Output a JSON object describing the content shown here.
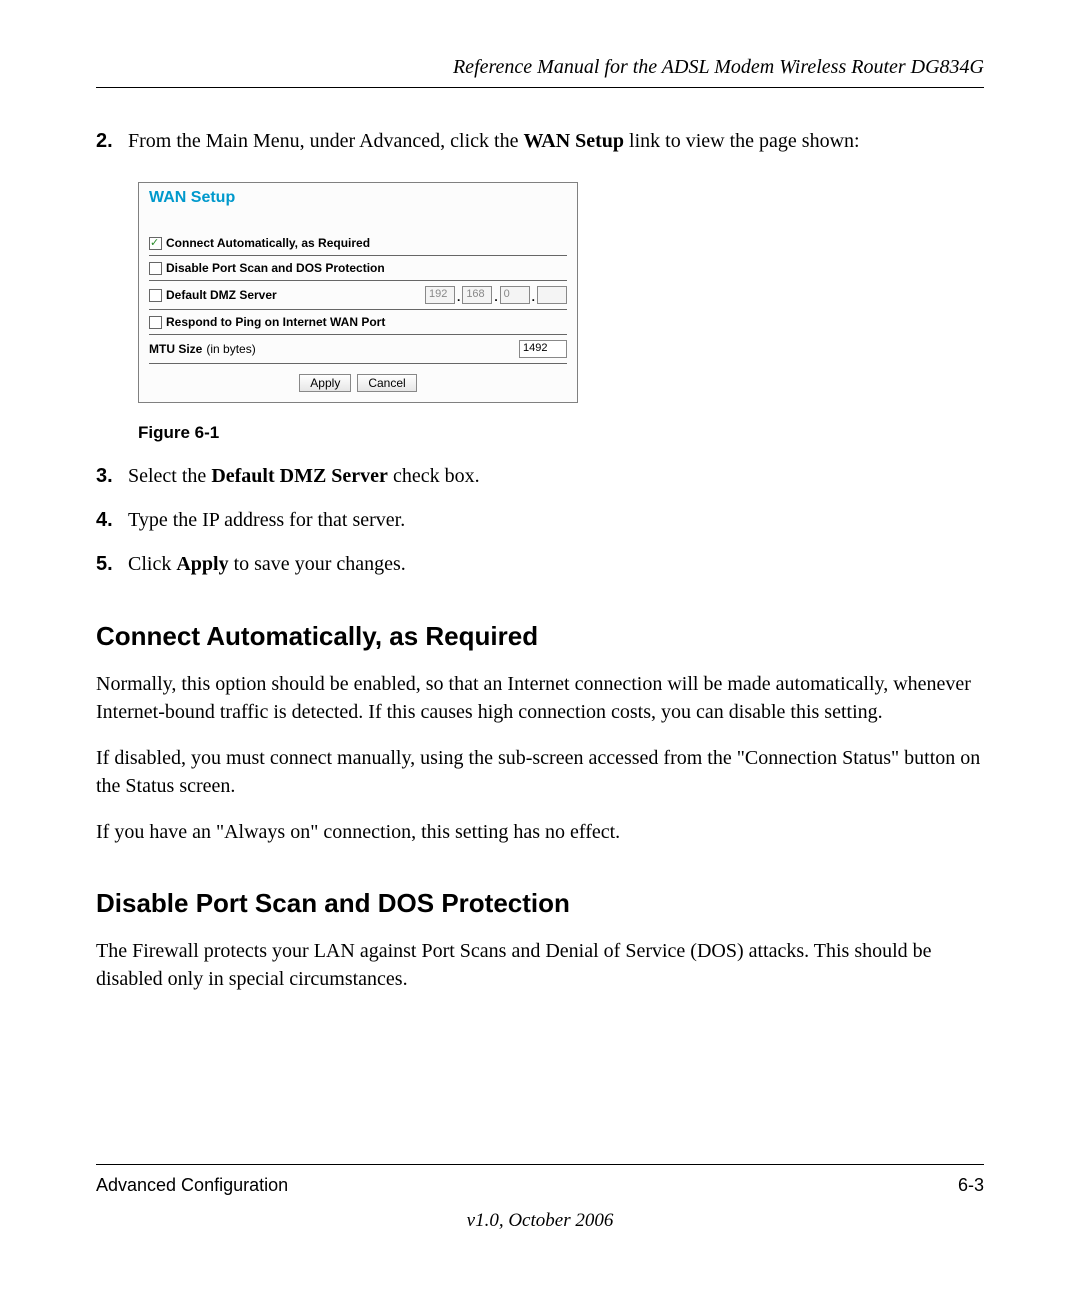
{
  "header": {
    "title": "Reference Manual for the ADSL Modem Wireless Router DG834G"
  },
  "steps": {
    "s2_num": "2.",
    "s2_a": "From the Main Menu, under Advanced, click the ",
    "s2_b": "WAN Setup",
    "s2_c": " link to view the page shown:",
    "s3_num": "3.",
    "s3_a": "Select the ",
    "s3_b": "Default DMZ Server",
    "s3_c": " check box.",
    "s4_num": "4.",
    "s4_text": "Type the IP address for that server.",
    "s5_num": "5.",
    "s5_a": "Click ",
    "s5_b": "Apply",
    "s5_c": " to save your changes."
  },
  "wan": {
    "title": "WAN Setup",
    "row1": "Connect Automatically, as Required",
    "row2": "Disable Port Scan and DOS Protection",
    "row3": "Default DMZ Server",
    "row4": "Respond to Ping on Internet WAN Port",
    "mtu_label": "MTU Size ",
    "mtu_units": "(in bytes)",
    "ip1": "192",
    "ip2": "168",
    "ip3": "0",
    "ip4": "",
    "mtu_value": "1492",
    "apply": "Apply",
    "cancel": "Cancel"
  },
  "figure_caption": "Figure 6-1",
  "sections": {
    "h_connect": "Connect Automatically, as Required",
    "p_connect1": "Normally, this option should be enabled, so that an Internet connection will be made automatically, whenever Internet-bound traffic is detected. If this causes high connection costs, you can disable this setting.",
    "p_connect2": "If disabled, you must connect manually, using the sub-screen accessed from the \"Connection Status\" button on the Status screen.",
    "p_connect3": "If you have an \"Always on\" connection, this setting has no effect.",
    "h_disable": "Disable Port Scan and DOS Protection",
    "p_disable": "The Firewall protects your LAN against Port Scans and Denial of Service (DOS) attacks. This should be disabled only in special circumstances."
  },
  "footer": {
    "left": "Advanced Configuration",
    "right": "6-3",
    "version": "v1.0, October 2006"
  }
}
